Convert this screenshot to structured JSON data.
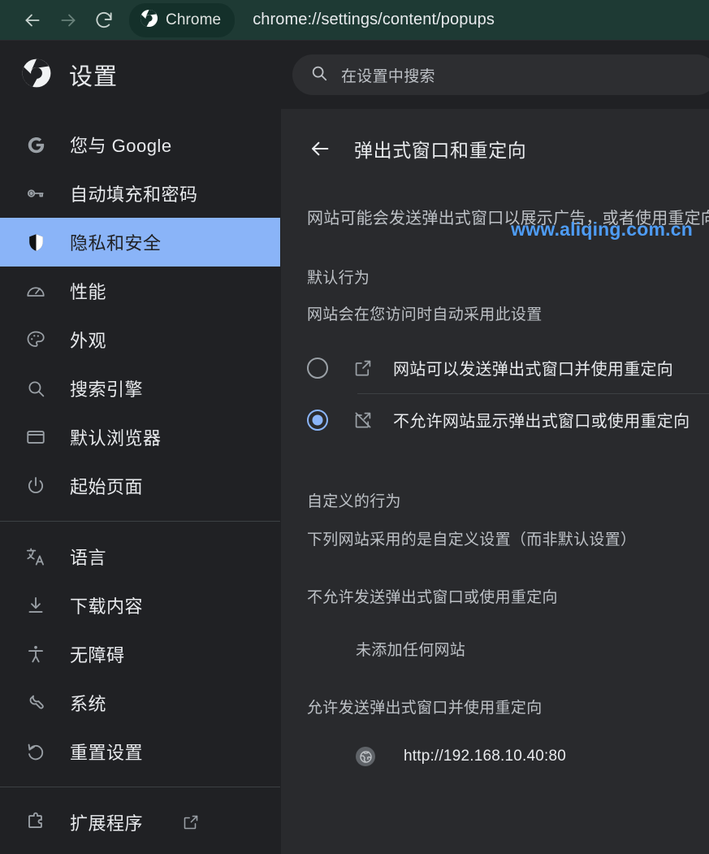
{
  "browser": {
    "back_icon": "arrow-left-icon",
    "forward_icon": "arrow-right-icon",
    "reload_icon": "reload-icon",
    "chrome_pill_label": "Chrome",
    "address": "chrome://settings/content/popups",
    "bar_color": "#1e3a34",
    "pill_color": "#14302a"
  },
  "settings_header": {
    "title": "设置",
    "search_placeholder": "在设置中搜索",
    "search_value": ""
  },
  "sidebar": {
    "items": [
      {
        "label": "您与 Google",
        "icon": "google-g-icon",
        "selected": false
      },
      {
        "label": "自动填充和密码",
        "icon": "key-icon",
        "selected": false
      },
      {
        "label": "隐私和安全",
        "icon": "shield-icon",
        "selected": true
      },
      {
        "label": "性能",
        "icon": "speedometer-icon",
        "selected": false
      },
      {
        "label": "外观",
        "icon": "palette-icon",
        "selected": false
      },
      {
        "label": "搜索引擎",
        "icon": "search-icon",
        "selected": false
      },
      {
        "label": "默认浏览器",
        "icon": "browser-window-icon",
        "selected": false
      },
      {
        "label": "起始页面",
        "icon": "power-icon",
        "selected": false
      },
      {
        "label": "语言",
        "icon": "translate-icon",
        "selected": false
      },
      {
        "label": "下载内容",
        "icon": "download-icon",
        "selected": false
      },
      {
        "label": "无障碍",
        "icon": "accessibility-icon",
        "selected": false
      },
      {
        "label": "系统",
        "icon": "wrench-icon",
        "selected": false
      },
      {
        "label": "重置设置",
        "icon": "restore-icon",
        "selected": false
      },
      {
        "label": "扩展程序",
        "icon": "extension-icon",
        "selected": false,
        "external": true
      }
    ],
    "selected_bg": "#8ab4f8"
  },
  "watermark": {
    "text": "www.aliqing.com.cn",
    "color": "#4e9cf5"
  },
  "main": {
    "back_icon": "arrow-back-icon",
    "page_title": "弹出式窗口和重定向",
    "description": "网站可能会发送弹出式窗口以展示广告，或者使用重定向",
    "default_behavior": {
      "heading": "默认行为",
      "subtext": "网站会在您访问时自动采用此设置",
      "options": [
        {
          "label": "网站可以发送弹出式窗口并使用重定向",
          "icon": "open-in-new-icon",
          "checked": false
        },
        {
          "label": "不允许网站显示弹出式窗口或使用重定向",
          "icon": "open-in-new-off-icon",
          "checked": true
        }
      ]
    },
    "custom_behavior": {
      "heading": "自定义的行为",
      "subtext": "下列网站采用的是自定义设置（而非默认设置）",
      "block_group_label": "不允许发送弹出式窗口或使用重定向",
      "block_group_empty": "未添加任何网站",
      "allow_group_label": "允许发送弹出式窗口并使用重定向",
      "allow_sites": [
        {
          "url": "http://192.168.10.40:80",
          "icon": "globe-icon"
        }
      ]
    }
  }
}
